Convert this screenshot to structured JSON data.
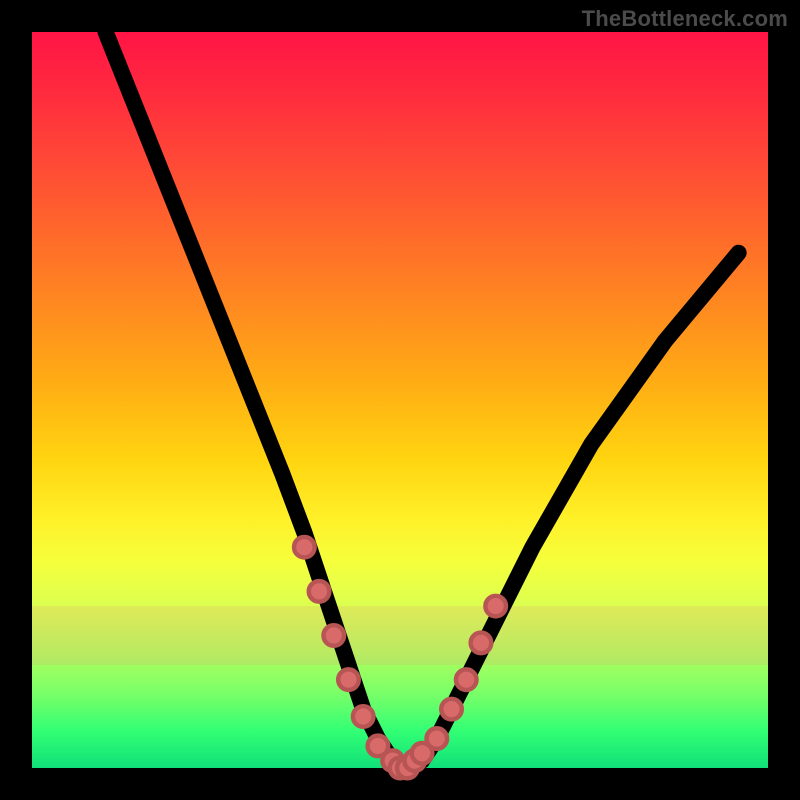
{
  "watermark_text": "TheBottleneck.com",
  "chart_data": {
    "type": "line",
    "title": "",
    "xlabel": "",
    "ylabel": "",
    "xlim": [
      0,
      100
    ],
    "ylim": [
      0,
      100
    ],
    "grid": false,
    "legend": false,
    "series": [
      {
        "name": "bottleneck-curve",
        "x": [
          10,
          14,
          18,
          22,
          26,
          30,
          34,
          37,
          39,
          41,
          43,
          45,
          47,
          49,
          51,
          53,
          55,
          58,
          62,
          68,
          76,
          86,
          96
        ],
        "values": [
          100,
          90,
          80,
          70,
          60,
          50,
          40,
          32,
          26,
          20,
          14,
          8,
          4,
          1,
          0,
          1,
          4,
          10,
          18,
          30,
          44,
          58,
          70
        ]
      }
    ],
    "markers": {
      "name": "highlighted-points",
      "x": [
        37,
        39,
        41,
        43,
        45,
        47,
        49,
        50,
        51,
        52,
        53,
        55,
        57,
        59,
        61,
        63
      ],
      "values": [
        30,
        24,
        18,
        12,
        7,
        3,
        1,
        0,
        0,
        1,
        2,
        4,
        8,
        12,
        17,
        22
      ]
    },
    "background_gradient": {
      "top": "#ff1446",
      "mid": "#ffd410",
      "bottom": "#10e079"
    }
  }
}
